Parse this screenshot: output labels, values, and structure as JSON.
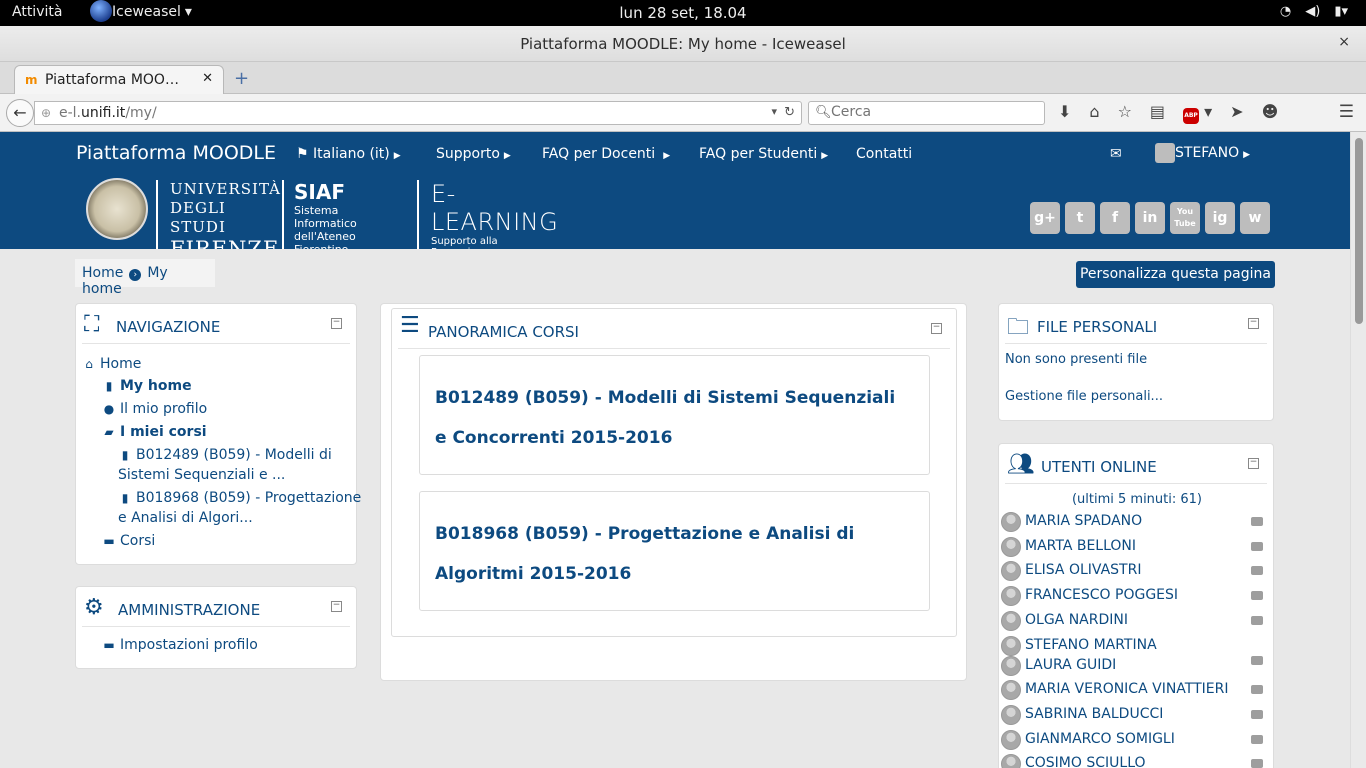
{
  "gnome": {
    "activities": "Attività",
    "app_name": "Iceweasel",
    "clock": "lun 28 set, 18.04"
  },
  "window": {
    "title": "Piattaforma MOODLE: My home - Iceweasel",
    "close": "×"
  },
  "tab": {
    "label": "Piattaforma MOO…",
    "close": "✕",
    "new": "+"
  },
  "urlbar": {
    "prefix": "e-l.",
    "domain": "unifi.it",
    "path": "/my/"
  },
  "search": {
    "placeholder": "Cerca"
  },
  "moodle": {
    "brand": "Piattaforma MOODLE",
    "menu": [
      "Italiano (it)",
      "Supporto",
      "FAQ per Docenti",
      "FAQ per Studenti",
      "Contatti"
    ],
    "user": "STEFANO",
    "logo": {
      "uni_1": "UNIVERSITÀ",
      "uni_2": "DEGLI STUDI",
      "uni_3": "FIRENZE",
      "siaf_1": "SIAF",
      "siaf_2": "Sistema Informatico",
      "siaf_3": "dell'Ateneo Fiorentino",
      "el_1": "E-LEARNING",
      "el_2": "Supporto alla Formazione"
    },
    "social": [
      "g+",
      "t",
      "f",
      "in",
      "You Tube",
      "ig",
      "w"
    ]
  },
  "breadcrumb": {
    "home": "Home",
    "current": "My home"
  },
  "customize_button": "Personalizza questa pagina",
  "navigation": {
    "title": "NAVIGAZIONE",
    "home": "Home",
    "my_home": "My home",
    "profile": "Il mio profilo",
    "my_courses": "I miei corsi",
    "course1_l1": "B012489 (B059) - Modelli di",
    "course1_l2": "Sistemi Sequenziali e ...",
    "course2_l1": "B018968 (B059) - Progettazione",
    "course2_l2": "e Analisi di Algori...",
    "courses": "Corsi"
  },
  "admin": {
    "title": "AMMINISTRAZIONE",
    "profile_settings": "Impostazioni profilo"
  },
  "overview": {
    "title": "PANORAMICA CORSI",
    "courses": [
      "B012489 (B059) - Modelli di Sistemi Sequenziali e Concorrenti 2015-2016",
      "B018968 (B059) - Progettazione e Analisi di Algoritmi 2015-2016"
    ]
  },
  "files": {
    "title": "FILE PERSONALI",
    "empty": "Non sono presenti file",
    "manage": "Gestione file personali..."
  },
  "online": {
    "title": "UTENTI ONLINE",
    "summary": "(ultimi 5 minuti: 61)",
    "users": [
      "MARIA SPADANO",
      "MARTA BELLONI",
      "ELISA OLIVASTRI",
      "FRANCESCO POGGESI",
      "OLGA NARDINI",
      "STEFANO MARTINA",
      "LAURA GUIDI",
      "MARIA VERONICA VINATTIERI",
      "SABRINA BALDUCCI",
      "GIANMARCO SOMIGLI",
      "COSIMO SCIULLO"
    ]
  }
}
